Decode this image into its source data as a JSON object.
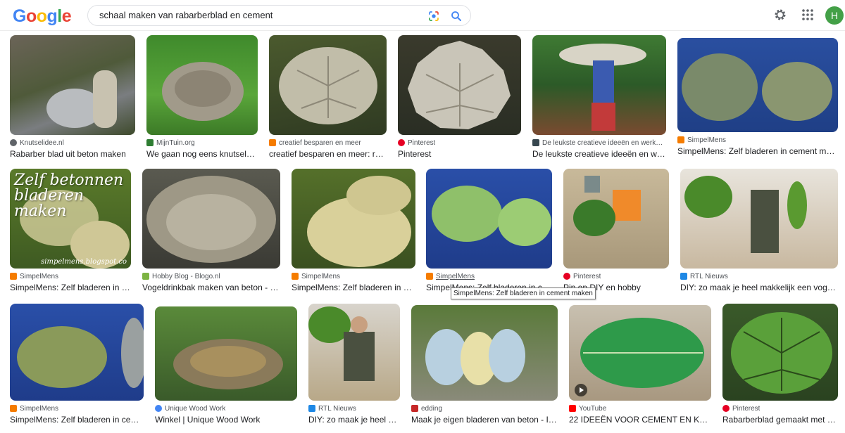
{
  "header": {
    "logo": "Google",
    "query": "schaal maken van rabarberblad en cement",
    "avatar_letter": "H",
    "icons": [
      "lens-icon",
      "search-icon",
      "gear-icon",
      "apps-icon"
    ]
  },
  "colors": {
    "google_blue": "#4285F4",
    "google_red": "#EA4335",
    "google_yellow": "#FBBC05",
    "google_green": "#34A853",
    "avatar": "#43a047"
  },
  "tooltip": "SimpelMens: Zelf bladeren in cement maken",
  "results": [
    {
      "source": "Knutselidee.nl",
      "title": "Rabarber blad uit beton maken",
      "favicon": "#5f6368"
    },
    {
      "source": "MijnTuin.org",
      "title": "We gaan nog eens knutselen…",
      "favicon": "#2e7d32"
    },
    {
      "source": "creatief besparen en meer",
      "title": "creatief besparen en meer: rab…",
      "favicon": "#f57c00"
    },
    {
      "source": "Pinterest",
      "title": "Pinterest",
      "favicon": "#e60023"
    },
    {
      "source": "De leukste creatieve ideeën en werkb…",
      "title": "De leukste creatieve ideeën en wer…",
      "favicon": "#37474f"
    },
    {
      "source": "SimpelMens",
      "title": "SimpelMens: Zelf bladeren in cement maken",
      "favicon": "#f57c00"
    },
    {
      "source": "SimpelMens",
      "title": "SimpelMens: Zelf bladeren in c…",
      "favicon": "#f57c00",
      "overlay": "Zelf betonnen bladeren maken",
      "watermark": "simpelmens.blogspot.co"
    },
    {
      "source": "Hobby Blog - Blogo.nl",
      "title": "Vogeldrinkbak maken van beton - H…",
      "favicon": "#7cb342"
    },
    {
      "source": "SimpelMens",
      "title": "SimpelMens: Zelf bladeren in ce…",
      "favicon": "#f57c00"
    },
    {
      "source": "SimpelMens",
      "title": "SimpelMens: Zelf bladeren in ce…",
      "favicon": "#f57c00"
    },
    {
      "source": "Pinterest",
      "title": "Pin op DIY en hobby",
      "favicon": "#e60023"
    },
    {
      "source": "RTL Nieuws",
      "title": "DIY: zo maak je heel makkelijk een vogelb…",
      "favicon": "#1e88e5"
    },
    {
      "source": "SimpelMens",
      "title": "SimpelMens: Zelf bladeren in cem…",
      "favicon": "#f57c00"
    },
    {
      "source": "Unique Wood Work",
      "title": "Winkel | Unique Wood Work",
      "favicon": "#4285F4"
    },
    {
      "source": "RTL Nieuws",
      "title": "DIY: zo maak je heel m…",
      "favicon": "#1e88e5"
    },
    {
      "source": "edding",
      "title": "Maak je eigen bladeren van beton - Ide…",
      "favicon": "#c62828"
    },
    {
      "source": "YouTube",
      "title": "22 IDEEËN VOOR CEMENT EN KLEI DI…",
      "favicon": "#ff0000"
    },
    {
      "source": "Pinterest",
      "title": "Rabarberblad gemaakt met b…",
      "favicon": "#e60023"
    }
  ]
}
